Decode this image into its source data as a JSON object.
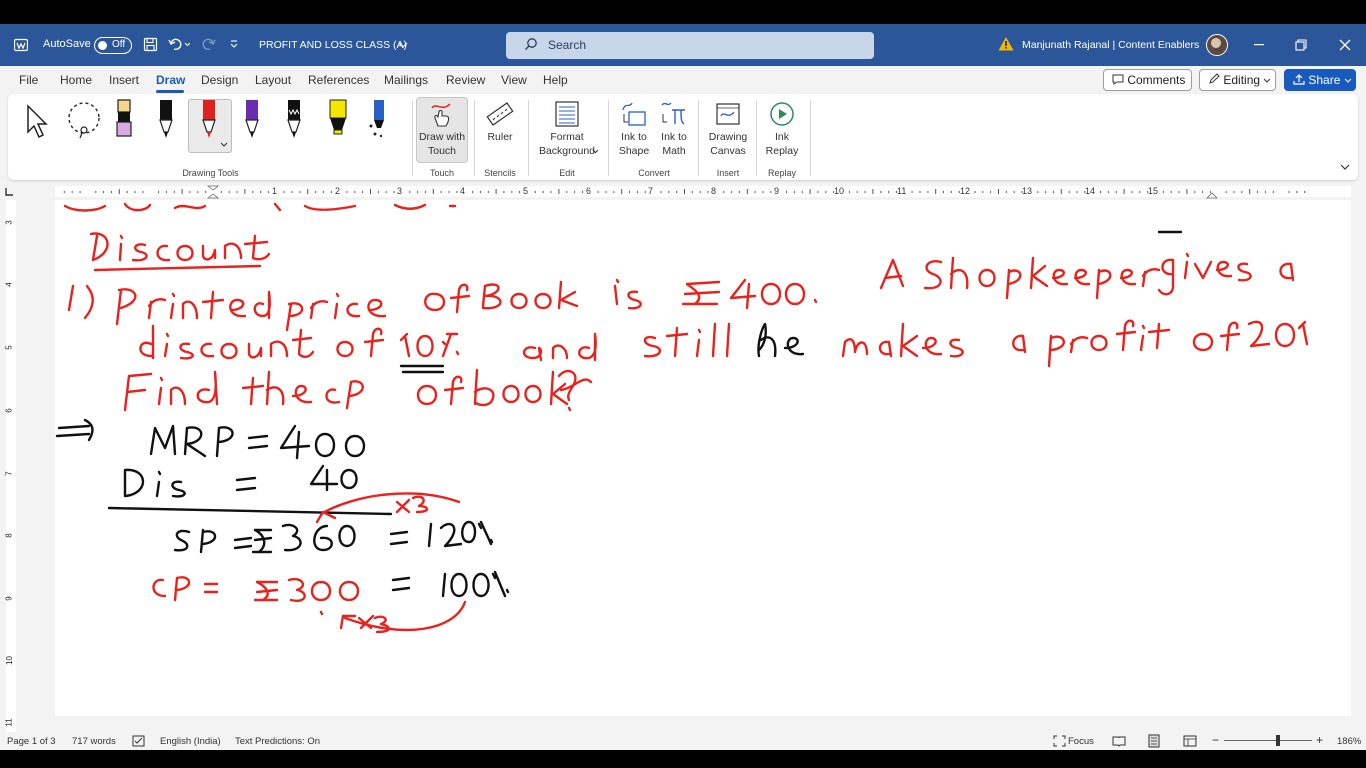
{
  "titlebar": {
    "autosave_label": "AutoSave",
    "autosave_state": "Off",
    "document_title": "PROFIT AND LOSS CLASS (A)",
    "search_placeholder": "Search",
    "user_name": "Manjunath Rajanal | Content Enablers",
    "accent_color": "#2b579a"
  },
  "tabs": [
    "File",
    "Home",
    "Insert",
    "Draw",
    "Design",
    "Layout",
    "References",
    "Mailings",
    "Review",
    "View",
    "Help"
  ],
  "active_tab": "Draw",
  "ribbon_right": {
    "comments_label": "Comments",
    "editing_label": "Editing",
    "share_label": "Share"
  },
  "ribbon": {
    "groups": {
      "drawing_tools": "Drawing Tools",
      "touch": "Touch",
      "stencils": "Stencils",
      "edit": "Edit",
      "convert": "Convert",
      "insert": "Insert",
      "replay": "Replay"
    },
    "buttons": {
      "draw_with_touch_1": "Draw with",
      "draw_with_touch_2": "Touch",
      "ruler": "Ruler",
      "format_bg_1": "Format",
      "format_bg_2": "Background",
      "ink_to_shape_1": "Ink to",
      "ink_to_shape_2": "Shape",
      "ink_to_math_1": "Ink to",
      "ink_to_math_2": "Math",
      "drawing_canvas_1": "Drawing",
      "drawing_canvas_2": "Canvas",
      "ink_replay_1": "Ink",
      "ink_replay_2": "Replay"
    },
    "pen_colors": [
      "#f2c9d6",
      "#1a1a1a",
      "#e0201e",
      "#6a2bb0",
      "#1a1a1a",
      "#f5e600",
      "#2a5fc8"
    ]
  },
  "ruler_numbers": [
    "1",
    "2",
    "3",
    "4",
    "5",
    "6",
    "7",
    "8",
    "9",
    "10",
    "11",
    "12",
    "13",
    "14",
    "15"
  ],
  "vruler_numbers": [
    "3",
    "4",
    "5",
    "6",
    "7",
    "8",
    "9",
    "10",
    "11"
  ],
  "statusbar": {
    "page": "Page 1 of 3",
    "words": "717 words",
    "language": "English (India)",
    "predictions": "Text Predictions: On",
    "focus": "Focus",
    "zoom": "186%"
  },
  "ink_colors": {
    "red": "#e8221c",
    "black": "#111111"
  }
}
